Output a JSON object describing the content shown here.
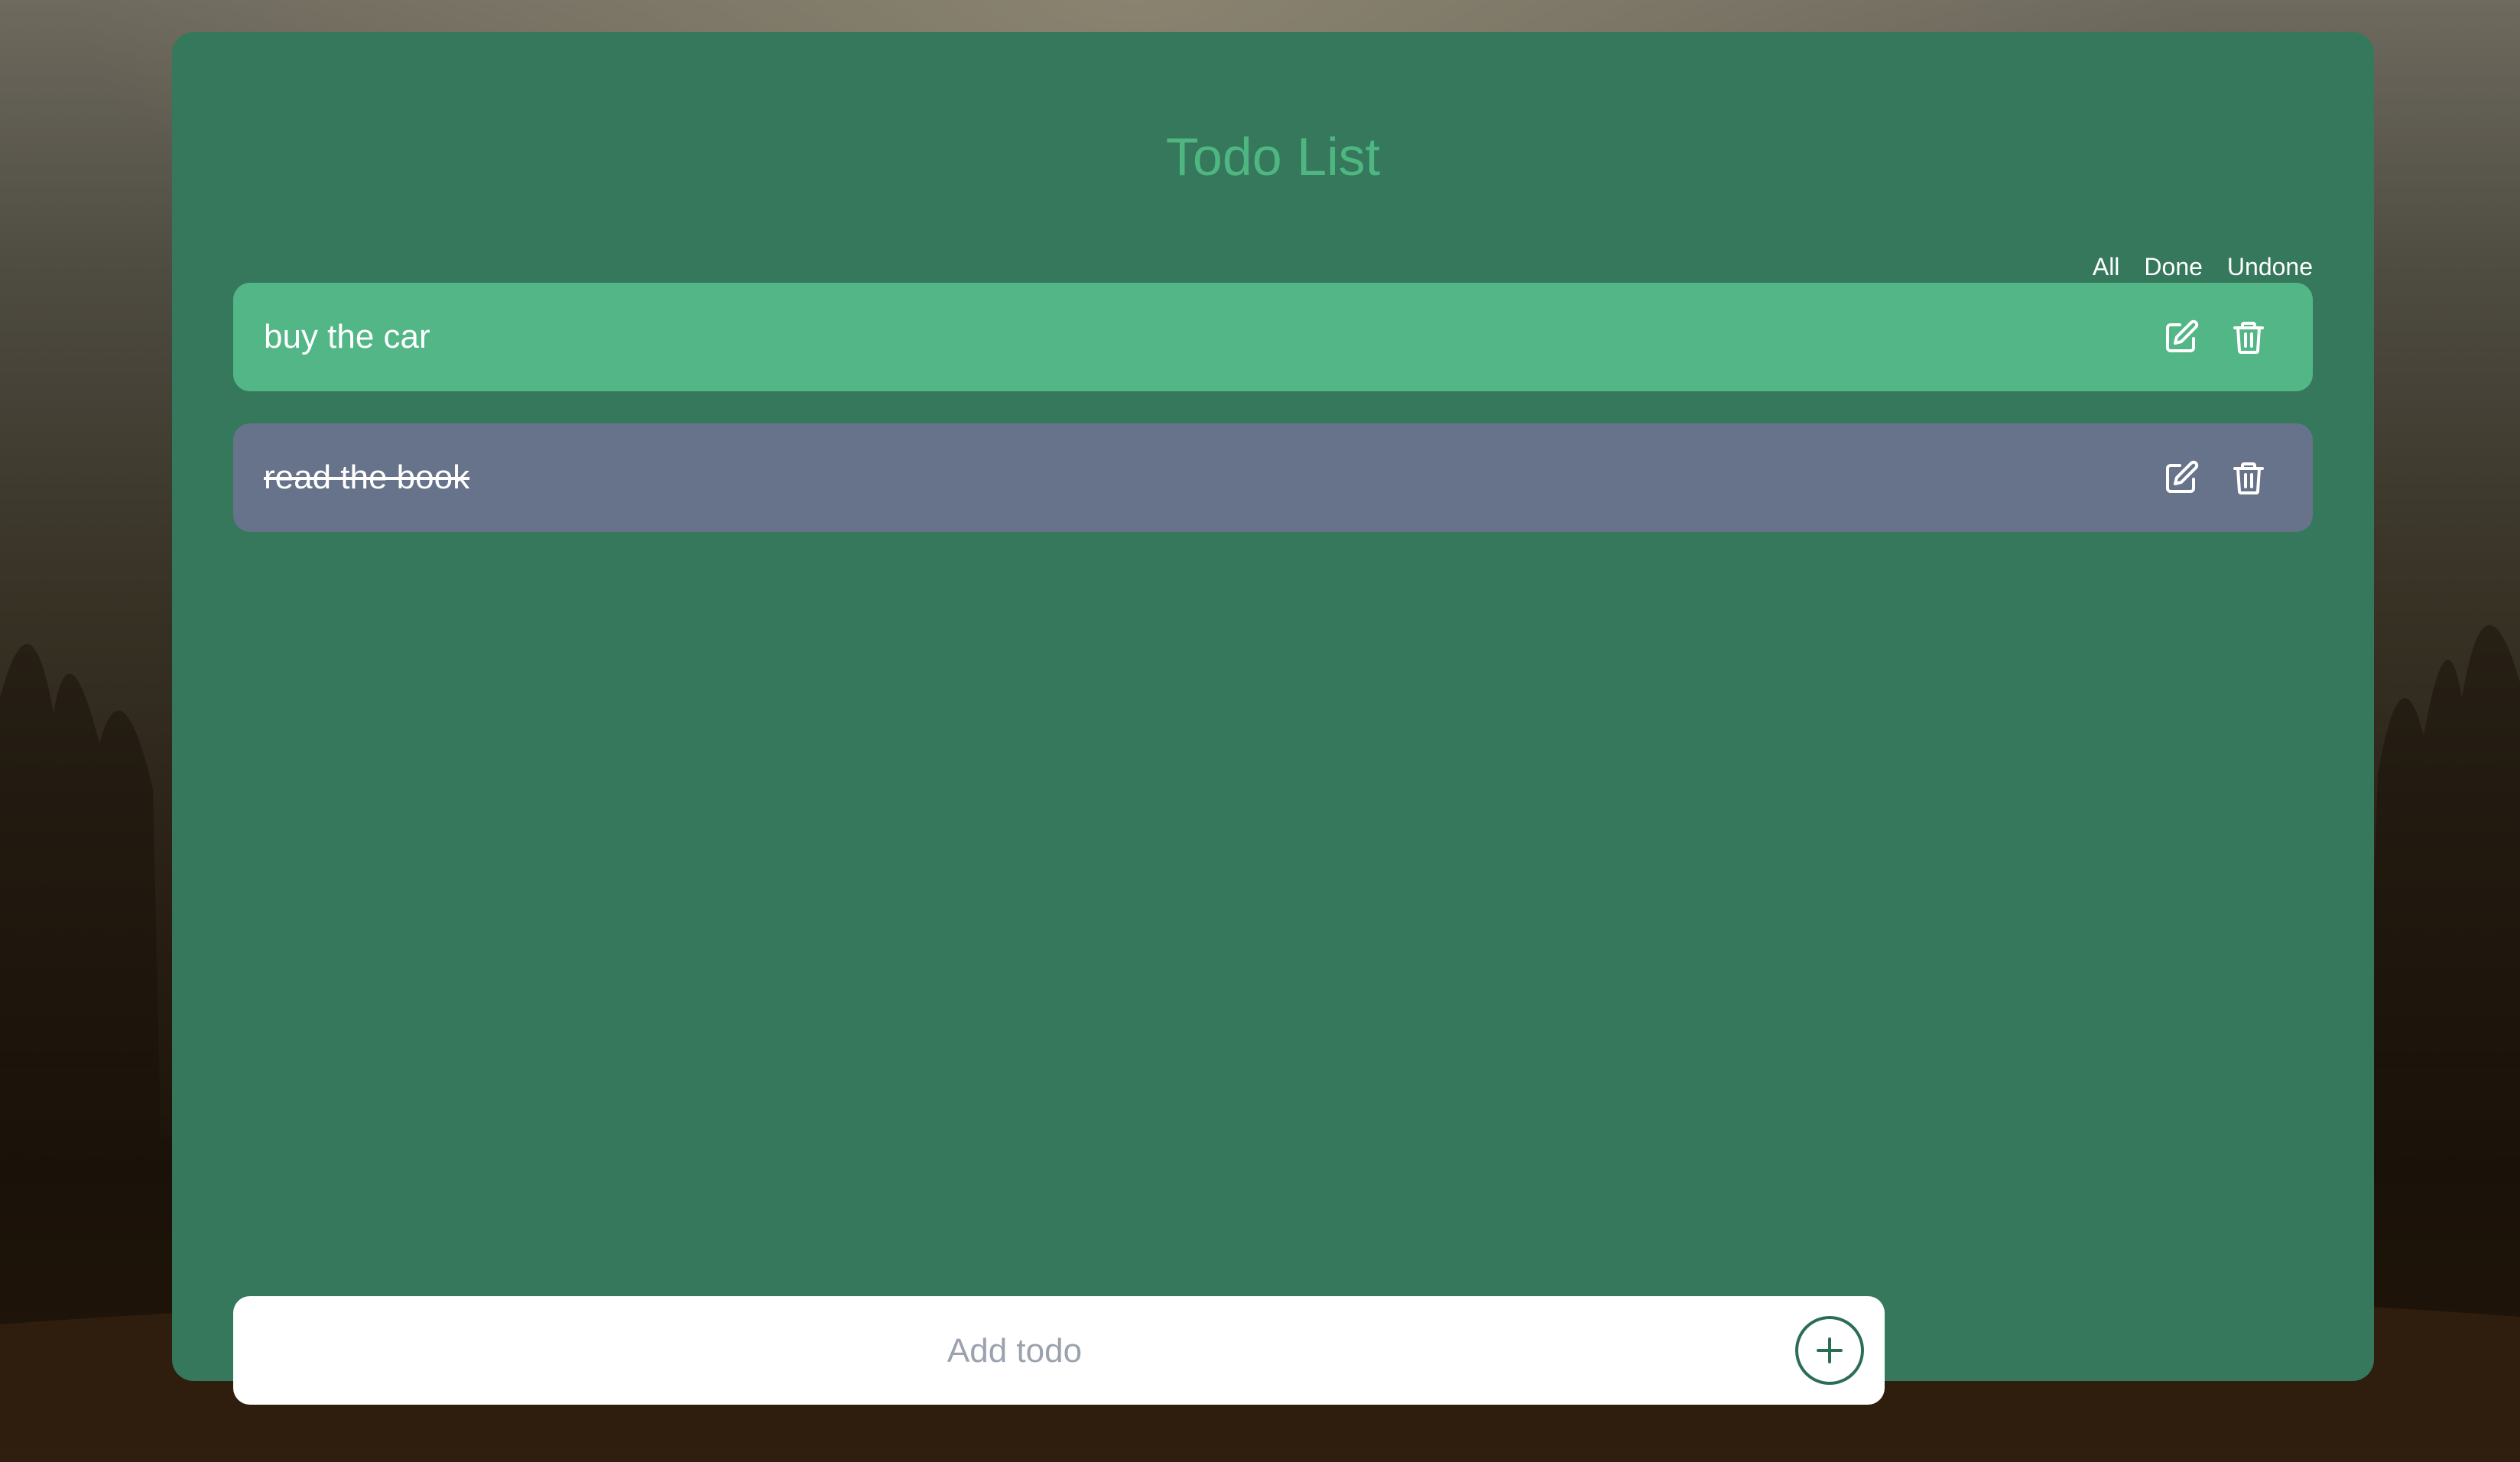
{
  "app": {
    "title": "Todo List"
  },
  "filters": {
    "all": "All",
    "done": "Done",
    "undone": "Undone"
  },
  "todos": [
    {
      "text": "buy the car",
      "status": "undone",
      "color": "#52b686"
    },
    {
      "text": "read the book",
      "status": "done",
      "color": "#67738a"
    }
  ],
  "add": {
    "placeholder": "Add todo",
    "value": ""
  },
  "icons": {
    "edit": "edit-icon",
    "delete": "trash-icon",
    "add": "plus-circle-icon"
  },
  "colors": {
    "panel": "#35785c",
    "title": "#4fb682",
    "accent": "#2c6e54"
  }
}
